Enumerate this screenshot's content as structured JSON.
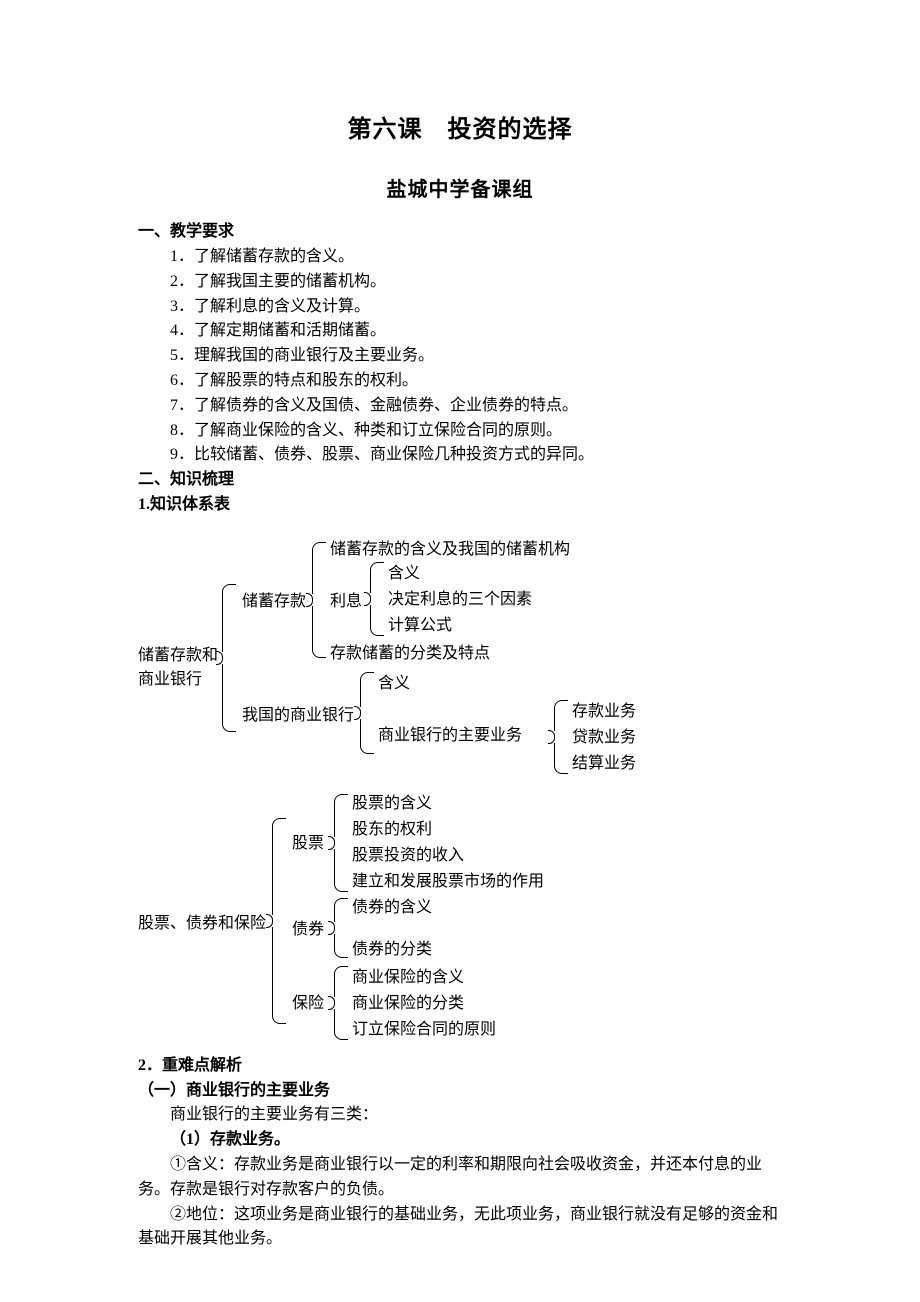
{
  "title": "第六课　投资的选择",
  "subtitle": "盐城中学备课组",
  "sections": {
    "requirements_heading": "一、教学要求",
    "requirements": [
      "1．了解储蓄存款的含义。",
      "2．了解我国主要的储蓄机构。",
      "3．了解利息的含义及计算。",
      "4．了解定期储蓄和活期储蓄。",
      "5．理解我国的商业银行及主要业务。",
      "6．了解股票的特点和股东的权利。",
      "7．了解债券的含义及国债、金融债券、企业债券的特点。",
      "8．了解商业保险的含义、种类和订立保险合同的原则。",
      "9．比较储蓄、债券、股票、商业保险几种投资方式的异同。"
    ],
    "knowledge_heading": "二、知识梳理",
    "knowledge_sub1": "1.知识体系表"
  },
  "diagram": {
    "root1a": "储蓄存款和",
    "root1b": "商业银行",
    "r1_savings": "储蓄存款",
    "r1_s_item1": "储蓄存款的含义及我国的储蓄机构",
    "r1_s_interest": "利息",
    "r1_s_i_a": "含义",
    "r1_s_i_b": "决定利息的三个因素",
    "r1_s_i_c": "计算公式",
    "r1_s_item3": "存款储蓄的分类及特点",
    "r1_bank": "我国的商业银行",
    "r1_b_a": "含义",
    "r1_b_b": "商业银行的主要业务",
    "r1_b_b_1": "存款业务",
    "r1_b_b_2": "贷款业务",
    "r1_b_b_3": "结算业务",
    "root2": "股票、债券和保险",
    "r2_stock": "股票",
    "r2_st_a": "股票的含义",
    "r2_st_b": "股东的权利",
    "r2_st_c": "股票投资的收入",
    "r2_st_d": "建立和发展股票市场的作用",
    "r2_bond": "债券",
    "r2_bd_a": "债券的含义",
    "r2_bd_b": "债券的分类",
    "r2_ins": "保险",
    "r2_in_a": "商业保险的含义",
    "r2_in_b": "商业保险的分类",
    "r2_in_c": "订立保险合同的原则"
  },
  "analysis": {
    "heading": "2．重难点解析",
    "sub1": "（一）商业银行的主要业务",
    "p1": "商业银行的主要业务有三类：",
    "sub1_1": "（1）存款业务。",
    "p2": "①含义：存款业务是商业银行以一定的利率和期限向社会吸收资金，并还本付息的业务。存款是银行对存款客户的负债。",
    "p3": "②地位：这项业务是商业银行的基础业务，无此项业务，商业银行就没有足够的资金和基础开展其他业务。"
  }
}
